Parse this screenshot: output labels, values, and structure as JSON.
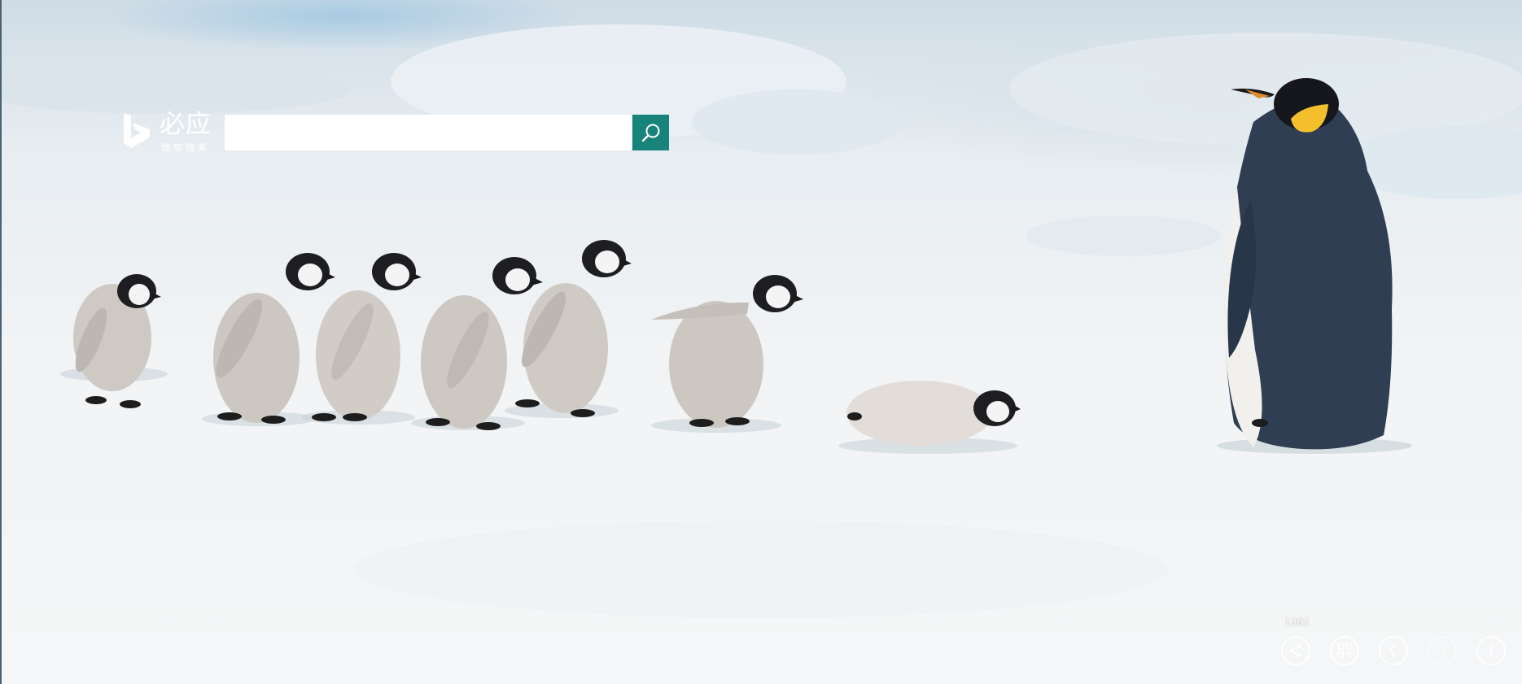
{
  "brand": {
    "name": "必应",
    "subtitle": "微软搜索"
  },
  "search": {
    "value": "",
    "placeholder": ""
  },
  "gallery": {
    "page_count": "1383"
  },
  "controls": [
    {
      "name": "share",
      "icon": "share-icon",
      "enabled": true
    },
    {
      "name": "qr-code",
      "icon": "qr-code-icon",
      "enabled": true
    },
    {
      "name": "previous",
      "icon": "chevron-left-icon",
      "enabled": true
    },
    {
      "name": "next",
      "icon": "chevron-right-icon",
      "enabled": false
    },
    {
      "name": "info",
      "icon": "info-icon",
      "enabled": true
    }
  ],
  "colors": {
    "search_button": "#17837a",
    "icon_white": "#ffffff"
  }
}
